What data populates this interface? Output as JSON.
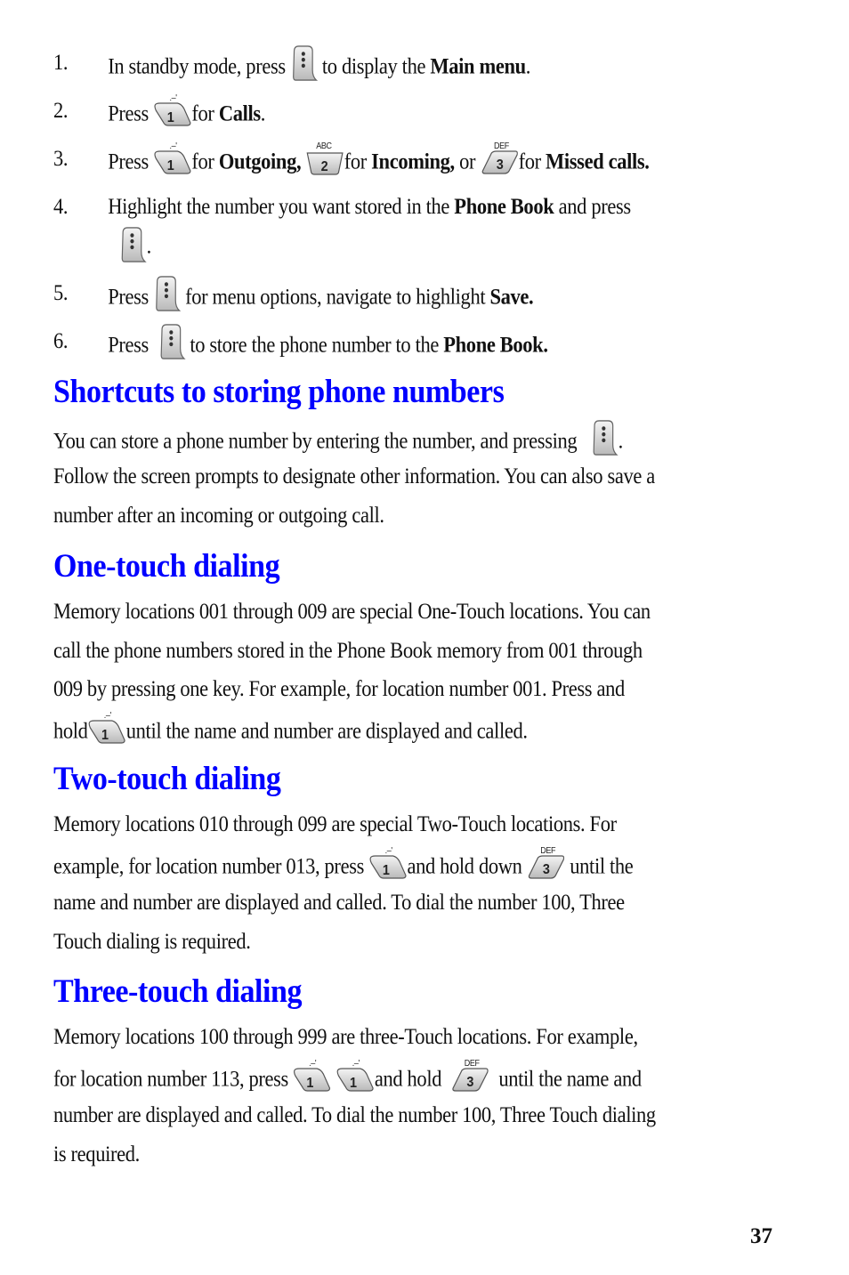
{
  "steps": [
    {
      "num": "1.",
      "parts": [
        "In standby mode, press",
        "to display the",
        "Main menu",
        "."
      ]
    },
    {
      "num": "2.",
      "parts": [
        "Press",
        "for",
        "Calls",
        "."
      ]
    },
    {
      "num": "3.",
      "parts": [
        "Press",
        "for",
        "Outgoing,",
        "for",
        "Incoming,",
        "or",
        "for",
        "Missed calls."
      ]
    },
    {
      "num": "4.",
      "parts": [
        "Highlight the number you want stored in the",
        "Phone Book",
        "and press",
        "."
      ]
    },
    {
      "num": "5.",
      "parts": [
        "Press",
        "for menu options, navigate to highlight",
        "Save."
      ]
    },
    {
      "num": "6.",
      "parts": [
        "Press",
        "to store the phone number to the",
        "Phone Book."
      ]
    }
  ],
  "sections": [
    {
      "heading": "Shortcuts to storing phone numbers",
      "lines": [
        [
          "You can store a phone number by entering the number, and pressing",
          "."
        ],
        [
          "Follow the screen prompts to designate other information. You can also save a"
        ],
        [
          "number after an incoming or outgoing call."
        ]
      ]
    },
    {
      "heading": "One-touch dialing",
      "lines": [
        [
          "Memory locations 001 through 009 are special One-Touch locations. You can"
        ],
        [
          "call the phone numbers stored in the Phone Book memory from 001 through"
        ],
        [
          "009 by pressing one key. For example, for location number 001. Press and"
        ],
        [
          "hold",
          "until the name and number are displayed and called."
        ]
      ]
    },
    {
      "heading": "Two-touch dialing",
      "lines": [
        [
          "Memory locations 010 through 099 are special Two-Touch locations. For"
        ],
        [
          "example, for location number 013, press",
          "and hold down",
          "until the"
        ],
        [
          "name and number are displayed and called. To dial the number 100, Three"
        ],
        [
          "Touch dialing is required."
        ]
      ]
    },
    {
      "heading": "Three-touch dialing",
      "lines": [
        [
          "Memory locations 100 through 999 are three-Touch locations. For example,"
        ],
        [
          "for location number 113, press",
          "and hold",
          "until the name and"
        ],
        [
          "number are displayed and called. To dial the number 100, Three Touch dialing"
        ],
        [
          "is required."
        ]
      ]
    }
  ],
  "keys": {
    "menu": {
      "icon": "menu-softkey-icon"
    },
    "one": {
      "digit": "1",
      "sub": ".–'",
      "icon": "key-1-icon"
    },
    "two": {
      "digit": "2",
      "sub": "ABC",
      "icon": "key-2-icon"
    },
    "three": {
      "digit": "3",
      "sub": "DEF",
      "icon": "key-3-icon"
    }
  },
  "page_number": "37",
  "colors": {
    "heading": "#0000ff",
    "text": "#111111"
  }
}
